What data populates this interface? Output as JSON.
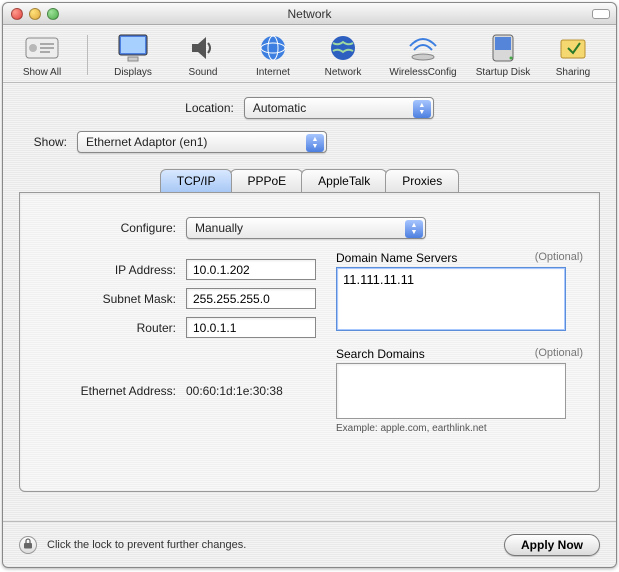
{
  "window": {
    "title": "Network"
  },
  "toolbar": {
    "show_all": "Show All",
    "displays": "Displays",
    "sound": "Sound",
    "internet": "Internet",
    "network": "Network",
    "wireless": "WirelessConfig",
    "startup": "Startup Disk",
    "sharing": "Sharing"
  },
  "location": {
    "label": "Location:",
    "value": "Automatic"
  },
  "show": {
    "label": "Show:",
    "value": "Ethernet Adaptor (en1)"
  },
  "tabs": {
    "tcpip": "TCP/IP",
    "pppoe": "PPPoE",
    "appletalk": "AppleTalk",
    "proxies": "Proxies"
  },
  "configure": {
    "label": "Configure:",
    "value": "Manually"
  },
  "ip": {
    "label": "IP Address:",
    "value": "10.0.1.202"
  },
  "subnet": {
    "label": "Subnet Mask:",
    "value": "255.255.255.0"
  },
  "router": {
    "label": "Router:",
    "value": "10.0.1.1"
  },
  "ethernet": {
    "label": "Ethernet Address:",
    "value": "00:60:1d:1e:30:38"
  },
  "dns": {
    "label": "Domain Name Servers",
    "optional": "(Optional)",
    "value": "11.111.11.11"
  },
  "search": {
    "label": "Search Domains",
    "optional": "(Optional)",
    "value": "",
    "example": "Example: apple.com, earthlink.net"
  },
  "footer": {
    "lock_text": "Click the lock to prevent further changes.",
    "apply": "Apply Now"
  }
}
